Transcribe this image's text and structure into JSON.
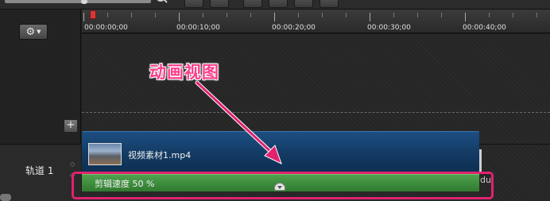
{
  "toolbar": {
    "buttons": [
      "search-icon",
      "undo-icon",
      "redo-icon",
      "cut-icon",
      "split-icon",
      "copy-icon",
      "paste-icon"
    ]
  },
  "left_panel": {
    "gear_icon": "gear-icon",
    "add_track_glyph": "+"
  },
  "timeline": {
    "ruler": {
      "ticks": [
        "00:00:00;00",
        "00:00:10;00",
        "00:00:20;00",
        "00:00:30;00",
        "00:00:40;00"
      ]
    },
    "tracks": [
      {
        "label": "轨道 1"
      }
    ],
    "clip": {
      "title": "视频素材1.mp4",
      "tail_text": "du"
    },
    "speed_bar": {
      "label": "剪辑速度 50 %"
    }
  },
  "annotation": {
    "label": "动画视图",
    "color": "#e0226f"
  },
  "colors": {
    "clip_blue": "#1d4f82",
    "speed_green": "#3f8f3f",
    "playhead_red": "#d23a3a"
  }
}
